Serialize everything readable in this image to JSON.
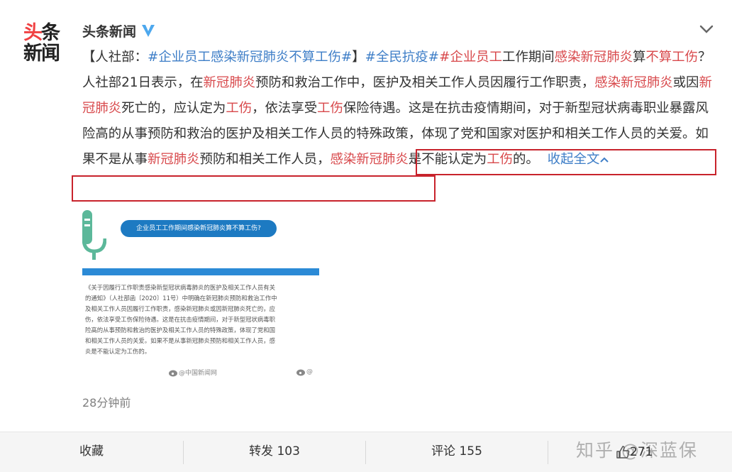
{
  "account": {
    "logo_line1_a": "头",
    "logo_line1_b": "条",
    "logo_line2": "新闻",
    "name": "头条新闻",
    "verified_icon": "verified-v-icon",
    "menu_icon": "chevron-down-icon"
  },
  "post": {
    "p01": "【人社部：",
    "p02": "#企业员工感染新冠肺炎不算工伤#",
    "p03": "】",
    "p04": "#全民抗疫#",
    "p05": "#企业员工",
    "p06": "工作期间",
    "p07": "感染新冠肺炎",
    "p08": "算",
    "p09": "不算工伤",
    "p10": "？人社部21日表示，在",
    "p11": "新冠肺炎",
    "p12": "预防和救治工作中，医护及相关工作人员因履行工作职责，",
    "p13": "感染新冠肺炎",
    "p14": "或因",
    "p15": "新冠肺炎",
    "p16": "死亡的，应认定为",
    "p17": "工伤",
    "p18": "，依法享受",
    "p19": "工伤",
    "p20": "保险待遇。这是在抗击疫情期间，对于新型冠状病毒职业暴露风险高的从事预防和救治的医护及相关工作人员的特殊政策，体现了党和国家对医护和相关工作人员的关爱。如果不是从事",
    "p21": "新冠肺炎",
    "p22": "预防和相关工作人员，",
    "p23": "感染新冠肺炎",
    "p24": "是不能认定为",
    "p25": "工伤",
    "p26": "的。",
    "collapse_label": "收起全文"
  },
  "image": {
    "question": "企业员工工作期间感染新冠肺炎算不算工伤?",
    "doc_text": "《关于因履行工作职责感染新型冠状病毒肺炎的医护及相关工作人员有关\n的通知》（人社部函〔2020〕11号）中明确在新冠肺炎预防和救治工作中\n及相关工作人员因履行工作职责，感染新冠肺炎或因新冠肺炎死亡的，应\n伤，依法享受工伤保险待遇。这是在抗击疫情期间，对于新型冠状病毒职\n险高的从事预防和救治的医护及相关工作人员的特殊政策，体现了党和国\n和相关工作人员的关爱。如果不是从事新冠肺炎预防和相关工作人员，感\n炎是不能认定为工伤的。",
    "watermark_1": "@中国新闻网",
    "watermark_2": "@"
  },
  "meta": {
    "time": "28分钟前"
  },
  "footer": {
    "favorite_label": "收藏",
    "repost_label": "转发 103",
    "comment_label": "评论 155",
    "like_icon": "thumbs-up-icon",
    "like_count": "271",
    "watermark": "知乎 @深蓝保"
  },
  "colors": {
    "link_blue": "#3e7ec7",
    "keyword_red": "#d8494c",
    "highlight_box": "#c8232c",
    "verified_blue": "#4da8ee"
  }
}
